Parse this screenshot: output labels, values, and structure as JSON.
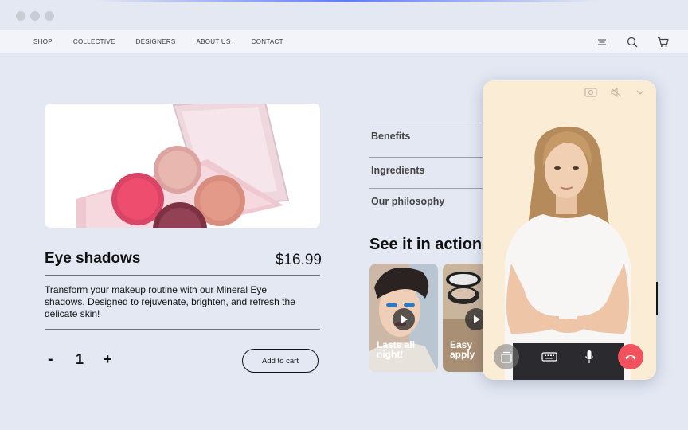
{
  "nav": {
    "links": [
      "SHOP",
      "COLLECTIVE",
      "DESIGNERS",
      "ABOUT US",
      "CONTACT"
    ],
    "icons": [
      "menu-icon",
      "search-icon",
      "cart-icon"
    ]
  },
  "product": {
    "title": "Eye shadows",
    "price": "$16.99",
    "description": "Transform your makeup routine with our Mineral Eye shadows. Designed to rejuvenate, brighten, and refresh the delicate skin!",
    "quantity": "1",
    "minus_label": "-",
    "plus_label": "+",
    "add_to_cart": "Add to cart"
  },
  "accordion": {
    "items": [
      "Benefits",
      "Ingredients",
      "Our philosophy"
    ]
  },
  "videos": {
    "heading": "See it in action!",
    "cards": [
      {
        "label_line1": "Lasts all",
        "label_line2": "night!"
      },
      {
        "label_line1": "Easy",
        "label_line2": "apply"
      }
    ]
  },
  "call": {
    "top_icons": [
      "camera-icon",
      "mute-icon",
      "chevron-down-icon"
    ],
    "controls": [
      "switch-view-icon",
      "keyboard-icon",
      "microphone-icon",
      "end-call-icon"
    ],
    "colors": {
      "end_call": "#f2525d",
      "background": "#fbecd6"
    }
  },
  "colors": {
    "page_bg": "#e3e8f3",
    "nav_bg": "#f2f4f9"
  }
}
